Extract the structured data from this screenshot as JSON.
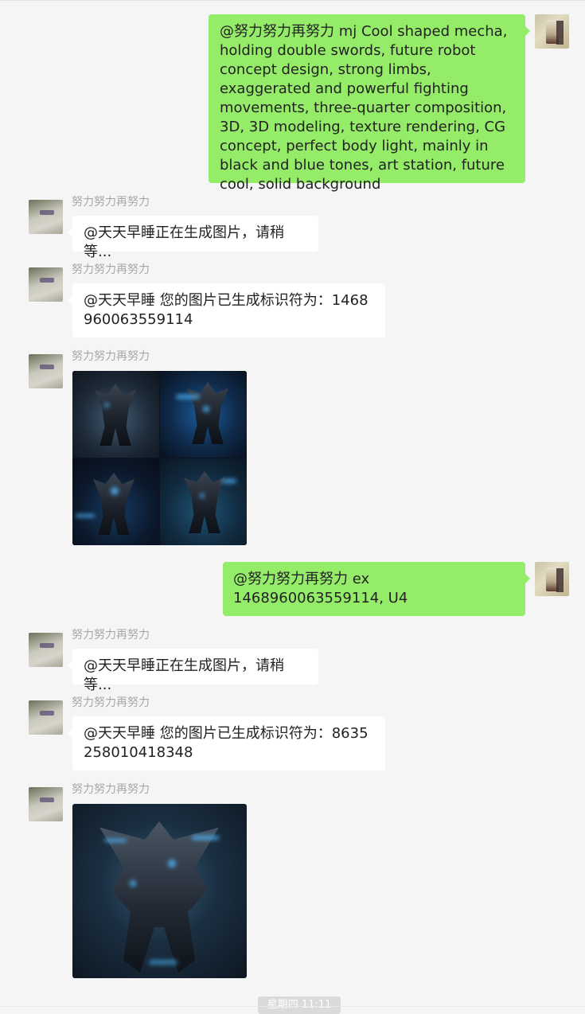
{
  "messages": [
    {
      "id": "m1",
      "from": "self",
      "text": "@努力努力再努力 mj Cool shaped mecha, holding double swords, future robot concept design, strong limbs, exaggerated and powerful fighting movements, three-quarter composition, 3D, 3D modeling, texture rendering, CG concept, perfect body light, mainly in black and blue tones, art station, future cool, solid background"
    },
    {
      "id": "m2",
      "from": "other",
      "sender": "努力努力再努力",
      "text": "@天天早睡正在生成图片，请稍等..."
    },
    {
      "id": "m3",
      "from": "other",
      "sender": "努力努力再努力",
      "text": "@天天早睡 您的图片已生成标识符为：1468960063559114"
    },
    {
      "id": "m4",
      "from": "other",
      "sender": "努力努力再努力",
      "image": "mecha-grid-4up"
    },
    {
      "id": "m5",
      "from": "self",
      "text": "@努力努力再努力 ex 1468960063559114, U4"
    },
    {
      "id": "m6",
      "from": "other",
      "sender": "努力努力再努力",
      "text": "@天天早睡正在生成图片，请稍等..."
    },
    {
      "id": "m7",
      "from": "other",
      "sender": "努力努力再努力",
      "text": "@天天早睡 您的图片已生成标识符为：8635258010418348"
    },
    {
      "id": "m8",
      "from": "other",
      "sender": "努力努力再努力",
      "image": "mecha-single-upscaled"
    }
  ],
  "timestamp": "星期四 11:11",
  "colors": {
    "self_bubble": "#95ec69",
    "other_bubble": "#ffffff",
    "background": "#f5f5f5",
    "sender_name": "#a7a7a7"
  }
}
